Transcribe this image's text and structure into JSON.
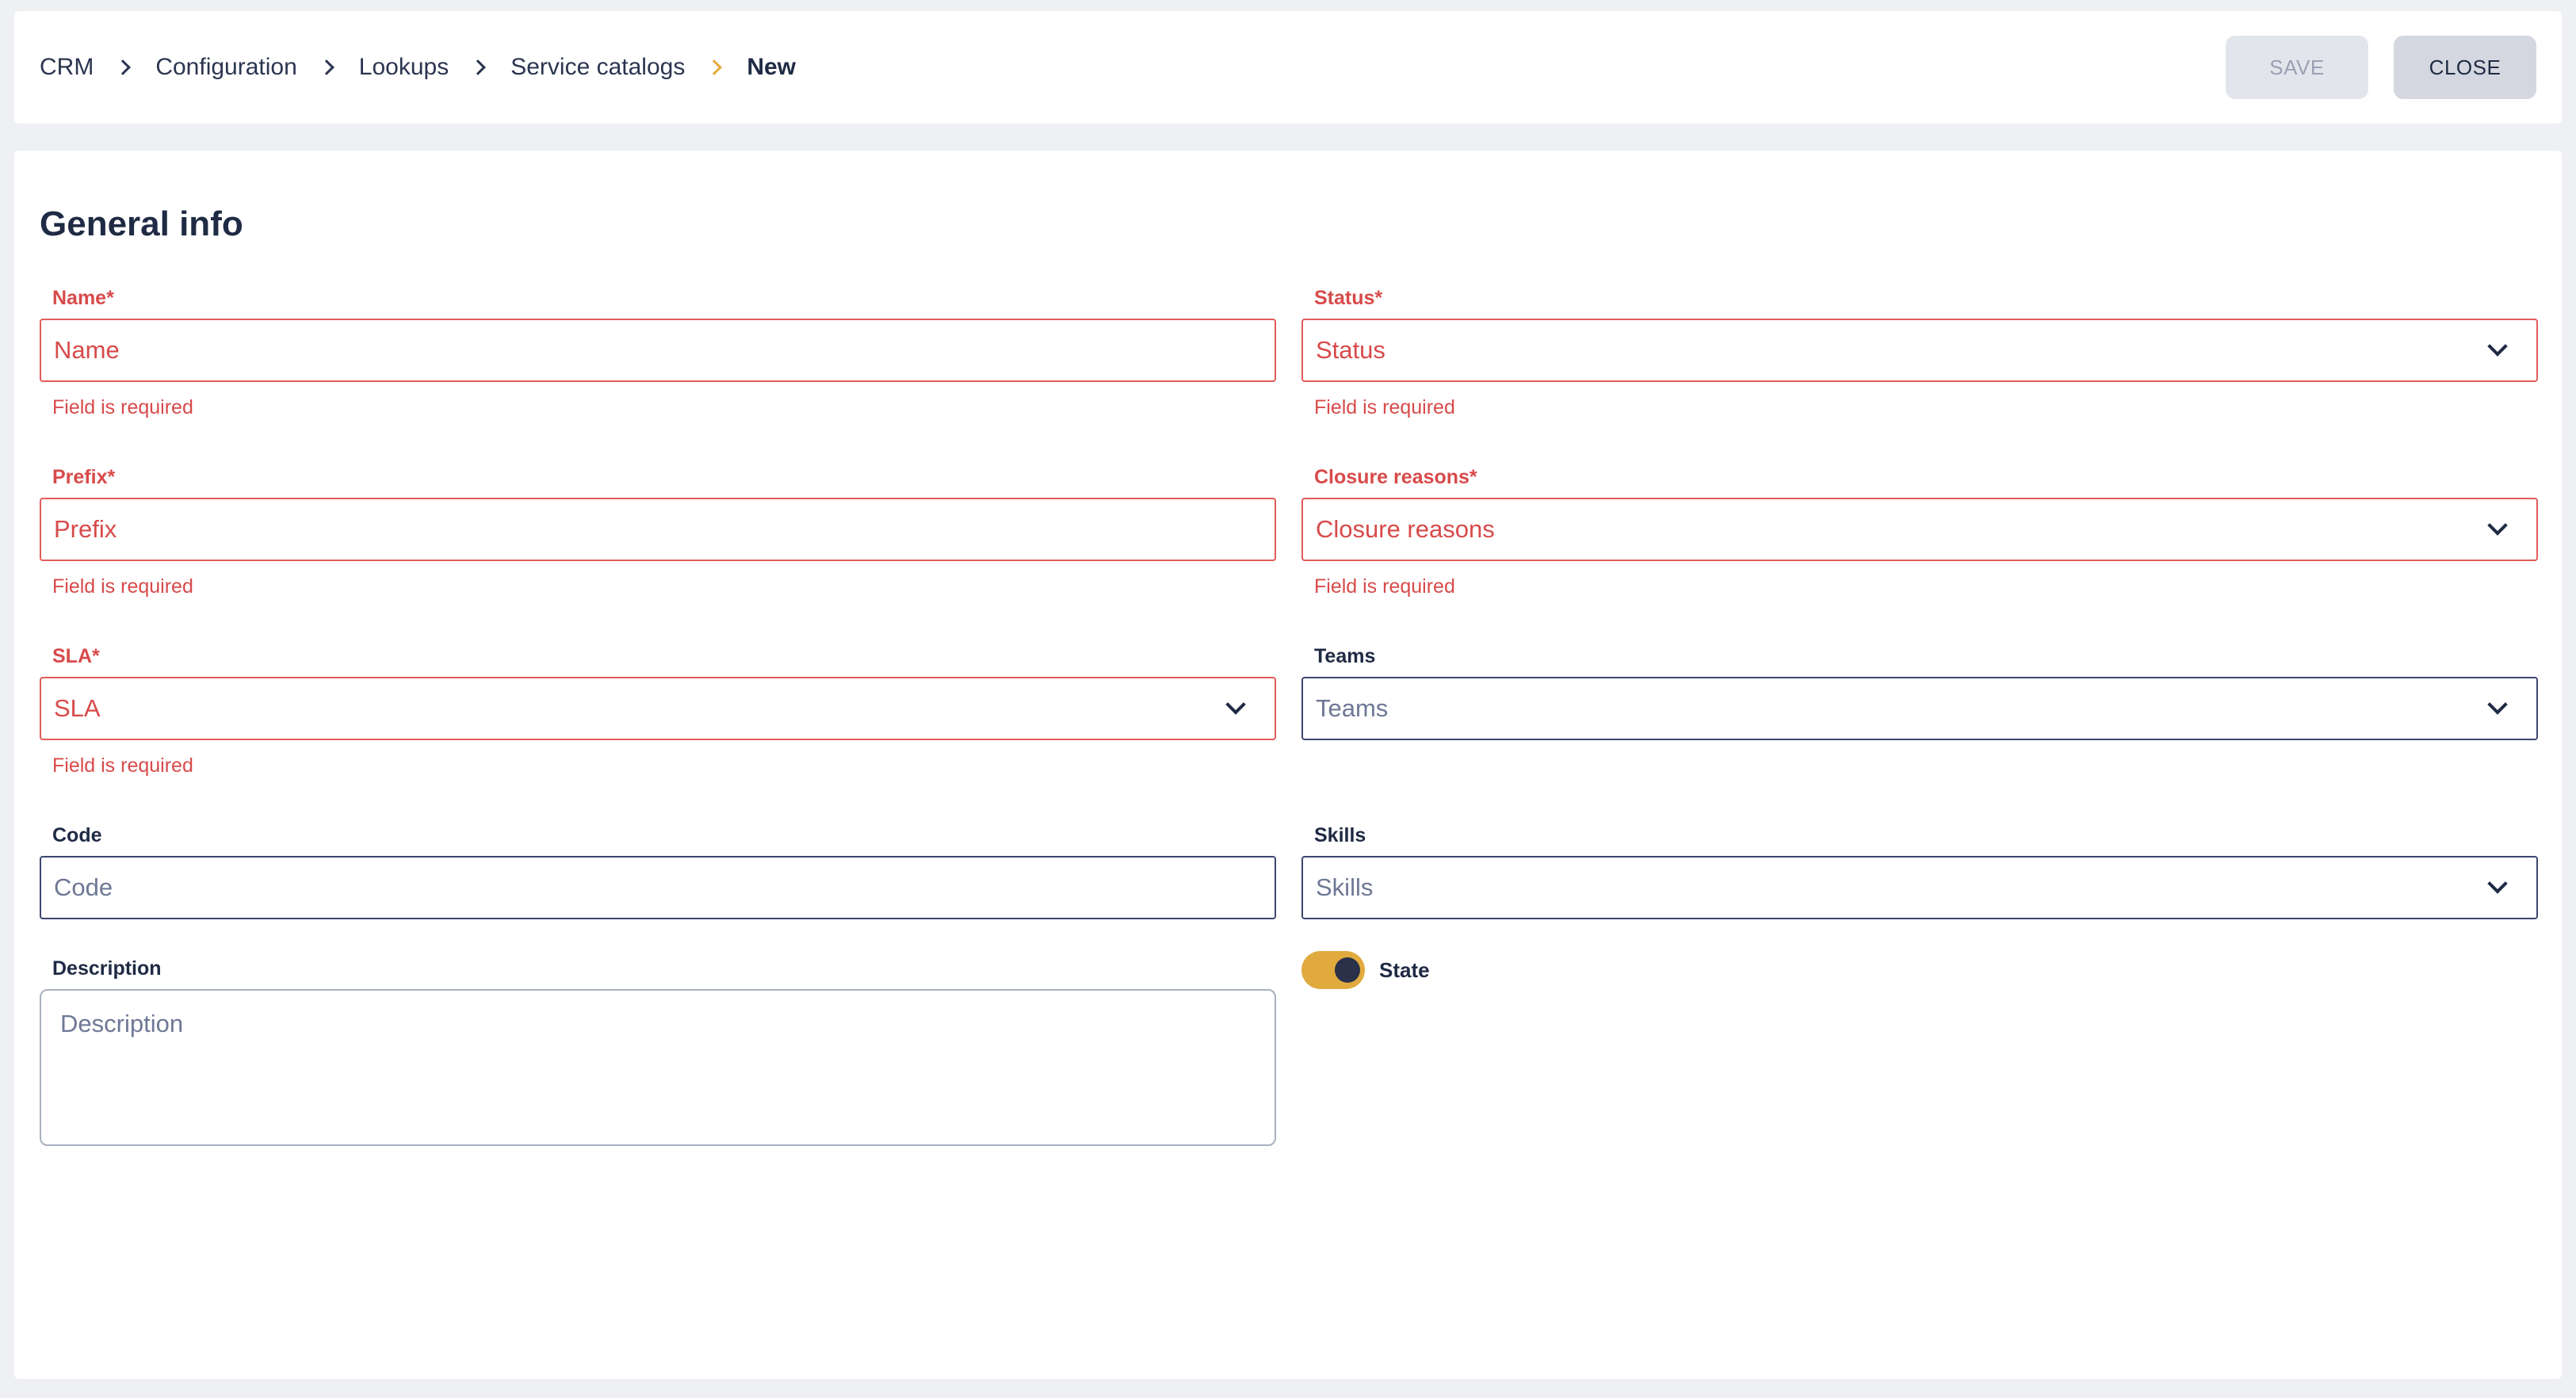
{
  "breadcrumb": {
    "items": [
      "CRM",
      "Configuration",
      "Lookups",
      "Service catalogs",
      "New"
    ]
  },
  "actions": {
    "save_label": "SAVE",
    "close_label": "CLOSE"
  },
  "section": {
    "title": "General info"
  },
  "fields": {
    "name": {
      "label": "Name*",
      "placeholder": "Name",
      "error": "Field is required"
    },
    "status": {
      "label": "Status*",
      "placeholder": "Status",
      "error": "Field is required"
    },
    "prefix": {
      "label": "Prefix*",
      "placeholder": "Prefix",
      "error": "Field is required"
    },
    "closure_reasons": {
      "label": "Closure reasons*",
      "placeholder": "Closure reasons",
      "error": "Field is required"
    },
    "sla": {
      "label": "SLA*",
      "placeholder": "SLA",
      "error": "Field is required"
    },
    "teams": {
      "label": "Teams",
      "placeholder": "Teams"
    },
    "code": {
      "label": "Code",
      "placeholder": "Code"
    },
    "skills": {
      "label": "Skills",
      "placeholder": "Skills"
    },
    "description": {
      "label": "Description",
      "placeholder": "Description"
    },
    "state": {
      "label": "State",
      "on": true
    }
  },
  "colors": {
    "error": "#d84a4a",
    "accent": "#e0aa3e",
    "text": "#1f2a44"
  }
}
